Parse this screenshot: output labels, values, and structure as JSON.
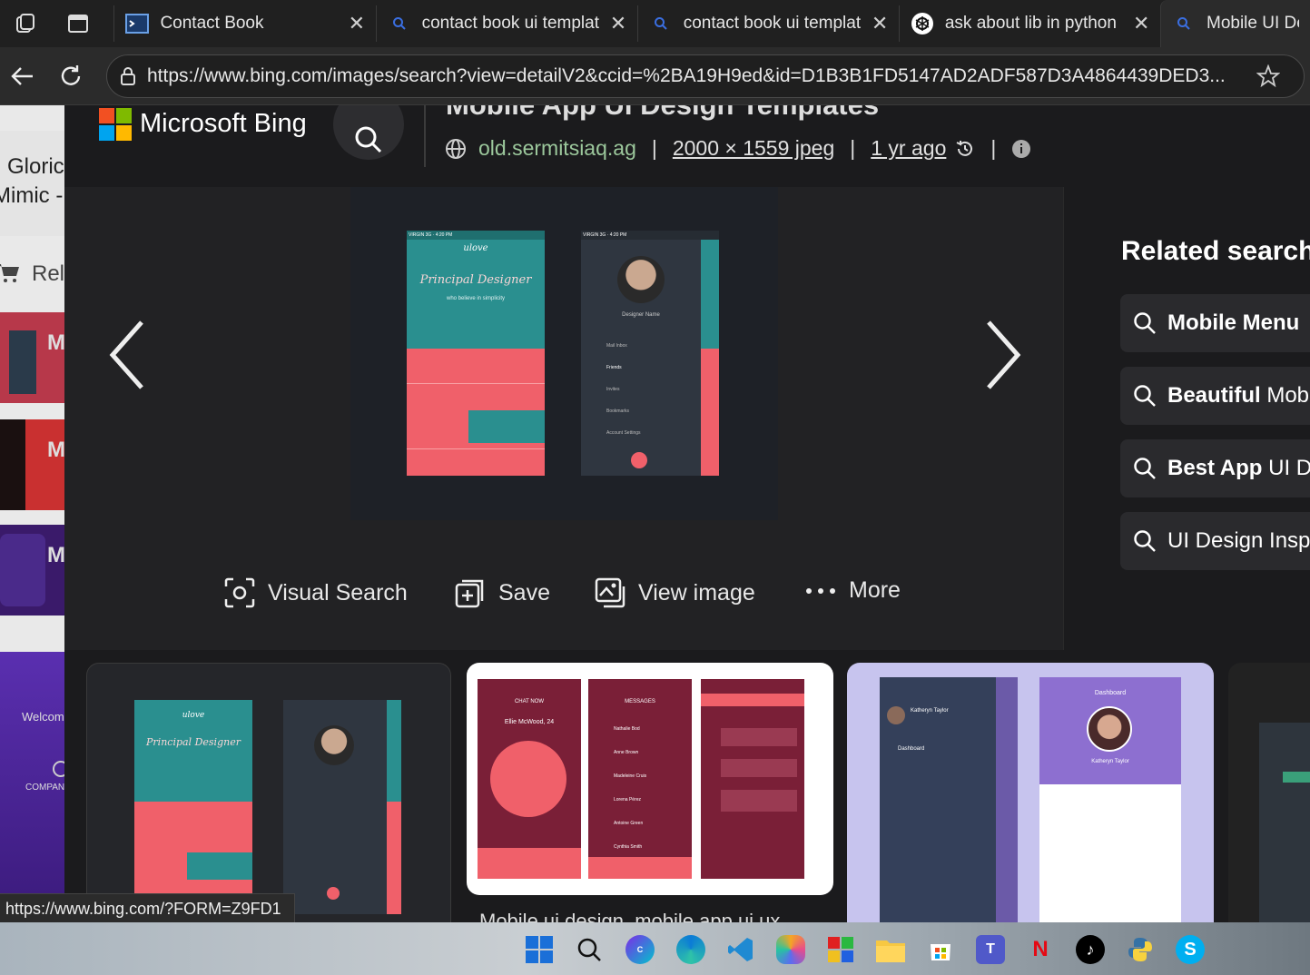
{
  "tabs": [
    {
      "title": "Contact Book"
    },
    {
      "title": "contact book ui templat"
    },
    {
      "title": "contact book ui templat"
    },
    {
      "title": "ask about lib in python"
    },
    {
      "title": "Mobile UI Des"
    }
  ],
  "address": {
    "url": "https://www.bing.com/images/search?view=detailV2&ccid=%2BA19H9ed&id=D1B3B1FD5147AD2ADF587D3A4864439DED3..."
  },
  "left_page": {
    "texts": [
      "Gloric",
      "Mimic -",
      "Rel"
    ],
    "thumb_labels": [
      "M",
      "M",
      "M",
      "Welcom",
      "COMPAN"
    ]
  },
  "bing": {
    "brand": "Microsoft Bing"
  },
  "detail": {
    "title": "Mobile App UI Design Templates",
    "source": "old.sermitsiaq.ag",
    "dimensions": "2000 × 1559 jpeg",
    "age": "1 yr ago"
  },
  "related": {
    "heading": "Related searche",
    "items": [
      {
        "bold": "Mobile Menu",
        "rest": ""
      },
      {
        "bold": "Beautiful",
        "rest": " Mob"
      },
      {
        "bold": "Best App",
        "rest": " UI D"
      },
      {
        "bold": "",
        "rest": "UI Design Insp"
      }
    ]
  },
  "actions": {
    "visual_search": "Visual Search",
    "save": "Save",
    "view_image": "View image",
    "more": "More"
  },
  "thumbs": {
    "caption": "Mobile ui design, mobile app ui ux"
  },
  "status_url": "https://www.bing.com/?FORM=Z9FD1",
  "phone_mock": {
    "left_brand": "ulove",
    "left_title": "Principal Designer",
    "left_sub": "who believe in simplicity",
    "right_name": "Designer Name",
    "menu": [
      "Mail Inbox",
      "Friends",
      "Invites",
      "Bookmarks",
      "Account Settings"
    ],
    "chat_name": "Ellie McWood, 24",
    "chat_header": "CHAT NOW",
    "messages_header": "MESSAGES",
    "messages": [
      "Nathalie Bod",
      "Anne Brown",
      "Madeleine Cruis",
      "Lorena Pérez",
      "Antoine Green",
      "Cynthia Smith"
    ],
    "dash_name": "Katheryn Taylor",
    "dash_title": "Dashboard"
  },
  "colors": {
    "overlay_bg": "#1b1b1d",
    "accent_green": "#9cc89c",
    "coral": "#f0606a",
    "teal": "#2a8f8f",
    "maroon": "#7a1f37",
    "purple": "#8d6fd0"
  }
}
